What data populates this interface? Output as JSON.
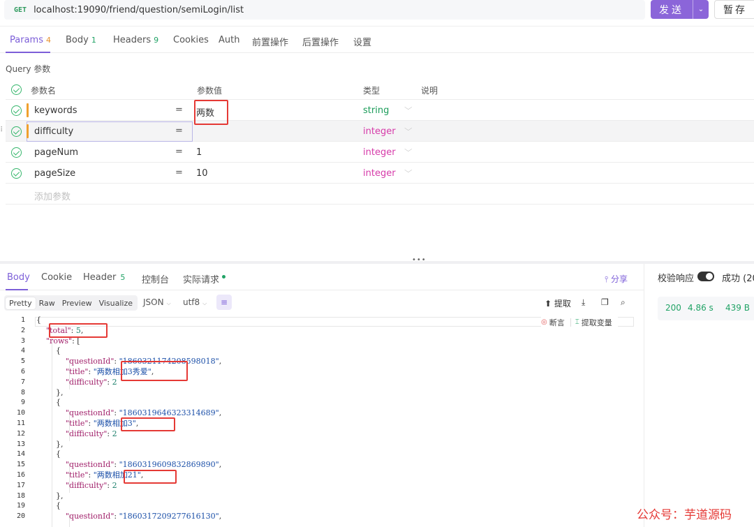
{
  "request": {
    "method": "GET",
    "url": "localhost:19090/friend/question/semiLogin/list",
    "send_label": "发送",
    "save_label": "暂存"
  },
  "request_tabs": [
    {
      "label": "Params",
      "count": "4"
    },
    {
      "label": "Body",
      "count": "1"
    },
    {
      "label": "Headers",
      "count": "9"
    },
    {
      "label": "Cookies",
      "count": ""
    },
    {
      "label": "Auth",
      "count": ""
    },
    {
      "label": "前置操作",
      "count": ""
    },
    {
      "label": "后置操作",
      "count": ""
    },
    {
      "label": "设置",
      "count": ""
    }
  ],
  "query": {
    "title": "Query 参数",
    "headers": {
      "name": "参数名",
      "value": "参数值",
      "type": "类型",
      "desc": "说明"
    },
    "params": [
      {
        "name": "keywords",
        "value": "两数",
        "type": "string"
      },
      {
        "name": "difficulty",
        "value": "",
        "type": "integer"
      },
      {
        "name": "pageNum",
        "value": "1",
        "type": "integer"
      },
      {
        "name": "pageSize",
        "value": "10",
        "type": "integer"
      }
    ],
    "add_placeholder": "添加参数"
  },
  "response_tabs": [
    {
      "label": "Body",
      "count": ""
    },
    {
      "label": "Cookie",
      "count": ""
    },
    {
      "label": "Header",
      "count": "5"
    },
    {
      "label": "控制台",
      "count": ""
    },
    {
      "label": "实际请求",
      "count": ""
    }
  ],
  "share_label": "分享",
  "toolbar": {
    "views": [
      "Pretty",
      "Raw",
      "Preview",
      "Visualize"
    ],
    "format": "JSON",
    "encoding": "utf8",
    "extract_label": "提取"
  },
  "inline_actions": {
    "assert_label": "断言",
    "extract_var_label": "提取变量"
  },
  "response_json": {
    "total": "5",
    "rows": [
      {
        "questionId": "\"1860321174208598018\"",
        "title": "\"两数相加3秀爱\"",
        "difficulty": "2"
      },
      {
        "questionId": "\"1860319646323314689\"",
        "title": "\"两数相加3\"",
        "difficulty": "2"
      },
      {
        "questionId": "\"1860319609832869890\"",
        "title": "\"两数相加21\"",
        "difficulty": "2"
      },
      {
        "questionId": "\"1860317209277616130\""
      }
    ]
  },
  "status_panel": {
    "validate_label": "校验响应",
    "result_label": "成功 (20",
    "status_code": "200",
    "time": "4.86 s",
    "size": "439 B"
  },
  "watermark": "公众号：芋道源码",
  "colors": {
    "accent": "#7c5ed8",
    "highlight": "#e53935",
    "success": "#21a366",
    "integer": "#d63aa9"
  }
}
